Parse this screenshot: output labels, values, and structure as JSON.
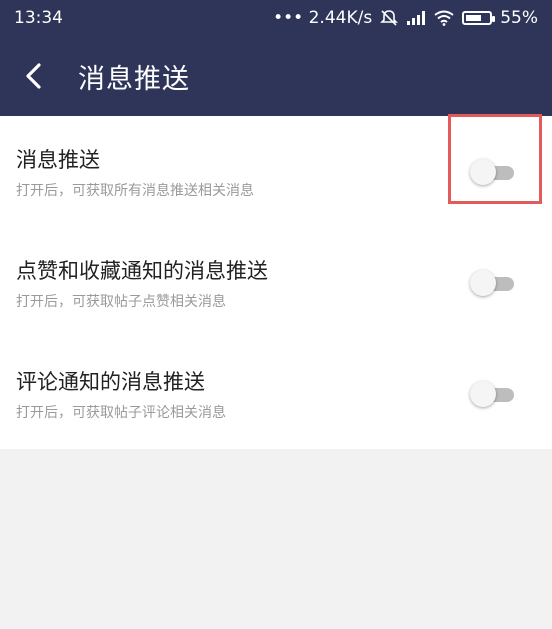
{
  "status_bar": {
    "time": "13:34",
    "network_speed": "••• 2.44K/s",
    "battery_percent": "55%",
    "icons": [
      "alarm-off-icon",
      "signal-icon",
      "wifi-icon",
      "battery-charging-icon"
    ]
  },
  "nav": {
    "title": "消息推送",
    "back_icon": "back-arrow-icon"
  },
  "settings": [
    {
      "title": "消息推送",
      "description": "打开后，可获取所有消息推送相关消息",
      "enabled": false
    },
    {
      "title": "点赞和收藏通知的消息推送",
      "description": "打开后，可获取帖子点赞相关消息",
      "enabled": false
    },
    {
      "title": "评论通知的消息推送",
      "description": "打开后，可获取帖子评论相关消息",
      "enabled": false
    }
  ],
  "colors": {
    "header_bg": "#2e3558",
    "highlight": "#e35a5a",
    "toggle_off_track": "#bdbdbd",
    "page_bg": "#f2f2f2"
  }
}
